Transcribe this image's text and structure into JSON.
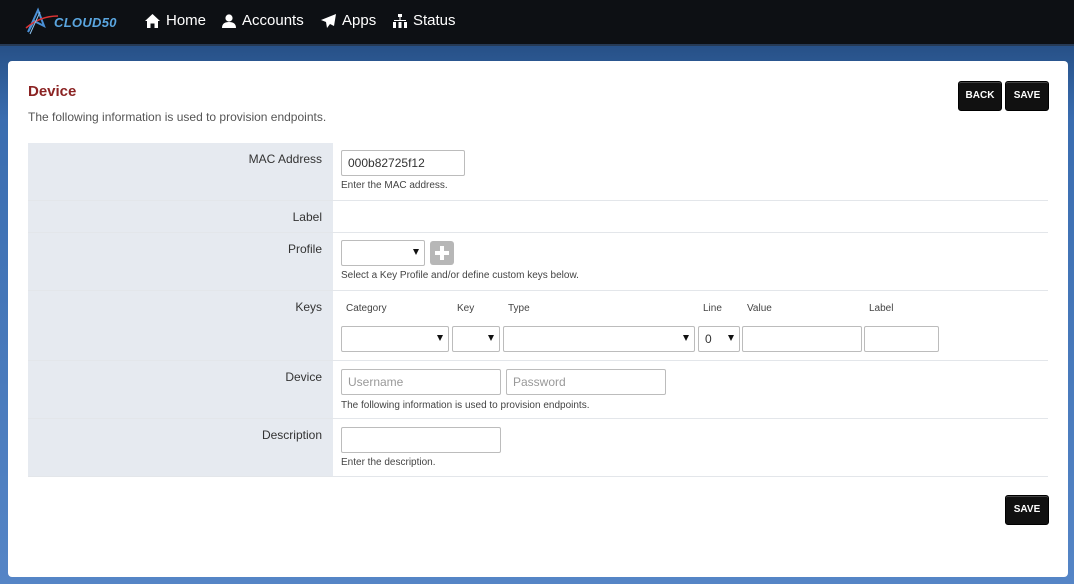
{
  "nav": {
    "logo_text": "CLOUD50",
    "items": [
      {
        "label": "Home",
        "icon": "home-icon"
      },
      {
        "label": "Accounts",
        "icon": "user-icon"
      },
      {
        "label": "Apps",
        "icon": "paper-plane-icon"
      },
      {
        "label": "Status",
        "icon": "sitemap-icon"
      }
    ]
  },
  "page": {
    "title": "Device",
    "subtitle": "The following information is used to provision endpoints.",
    "back_label": "BACK",
    "save_label": "SAVE",
    "save_bottom_label": "SAVE"
  },
  "form": {
    "mac": {
      "label": "MAC Address",
      "value": "000b82725f12",
      "help": "Enter the MAC address."
    },
    "label": {
      "label": "Label"
    },
    "profile": {
      "label": "Profile",
      "value": "",
      "help": "Select a Key Profile and/or define custom keys below."
    },
    "keys": {
      "label": "Keys",
      "columns": {
        "category": "Category",
        "key": "Key",
        "type": "Type",
        "line": "Line",
        "value": "Value",
        "label": "Label"
      },
      "line_value": "0"
    },
    "device": {
      "label": "Device",
      "username_placeholder": "Username",
      "password_placeholder": "Password",
      "help": "The following information is used to provision endpoints."
    },
    "description": {
      "label": "Description",
      "value": "",
      "help": "Enter the description."
    }
  },
  "colors": {
    "title": "#8b2323",
    "navbar": "#0d1014",
    "label_bg": "#e6eaf0",
    "button": "#111111"
  }
}
